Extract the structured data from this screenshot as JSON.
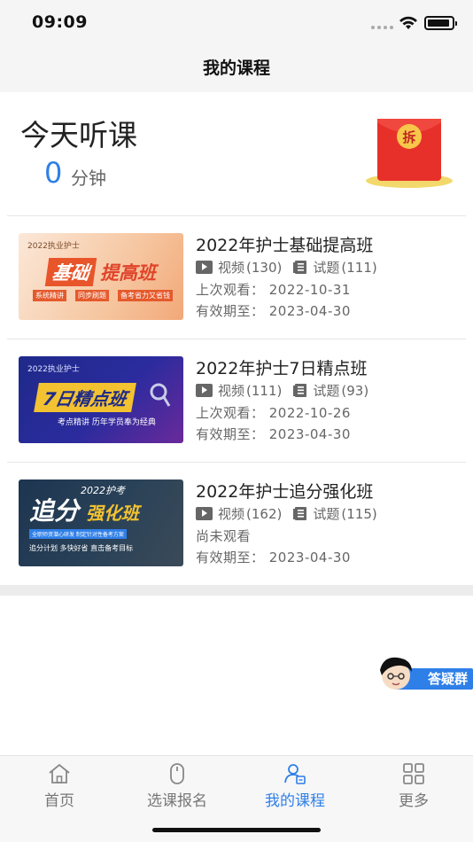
{
  "status_bar": {
    "time": "09:09"
  },
  "nav": {
    "title": "我的课程"
  },
  "today": {
    "title": "今天听课",
    "minutes": "0",
    "unit": "分钟",
    "redpacket_char": "拆"
  },
  "courses": [
    {
      "title": "2022年护士基础提高班",
      "thumb": {
        "small": "2022执业护士",
        "line1": "基础",
        "line2": "提高班",
        "sub1": "系统精讲",
        "sub2": "同步刷题",
        "sub3": "备考省力又省钱"
      },
      "video_label": "视频",
      "video_count": "(130)",
      "exam_label": "试题",
      "exam_count": "(111)",
      "watched": "上次观看：  2022-10-31",
      "valid": "有效期至：  2023-04-30"
    },
    {
      "title": "2022年护士7日精点班",
      "thumb": {
        "small": "2022执业护士",
        "line1": "7日精点班",
        "sub1": "考点精讲  历年学员奉为经典"
      },
      "video_label": "视频",
      "video_count": "(111)",
      "exam_label": "试题",
      "exam_count": "(93)",
      "watched": "上次观看：  2022-10-26",
      "valid": "有效期至：  2023-04-30"
    },
    {
      "title": "2022年护士追分强化班",
      "thumb": {
        "small": "2022护考",
        "line1": "追分",
        "line2": "强化班",
        "sub1": "全职师资潜心研发  制定针对性备考方案",
        "sub2": "追分计划  多快好省  直击备考目标"
      },
      "video_label": "视频",
      "video_count": "(162)",
      "exam_label": "试题",
      "exam_count": "(115)",
      "watched": "尚未观看",
      "valid": "有效期至：  2023-04-30"
    }
  ],
  "qa_badge": {
    "label": "答疑群"
  },
  "tabs": [
    {
      "label": "首页",
      "icon": "home-icon",
      "active": false
    },
    {
      "label": "选课报名",
      "icon": "mouse-icon",
      "active": false
    },
    {
      "label": "我的课程",
      "icon": "my-course-icon",
      "active": true
    },
    {
      "label": "更多",
      "icon": "grid-icon",
      "active": false
    }
  ],
  "colors": {
    "accent": "#2f7fe8",
    "red": "#e8302a",
    "text": "#222222",
    "muted": "#666666"
  }
}
